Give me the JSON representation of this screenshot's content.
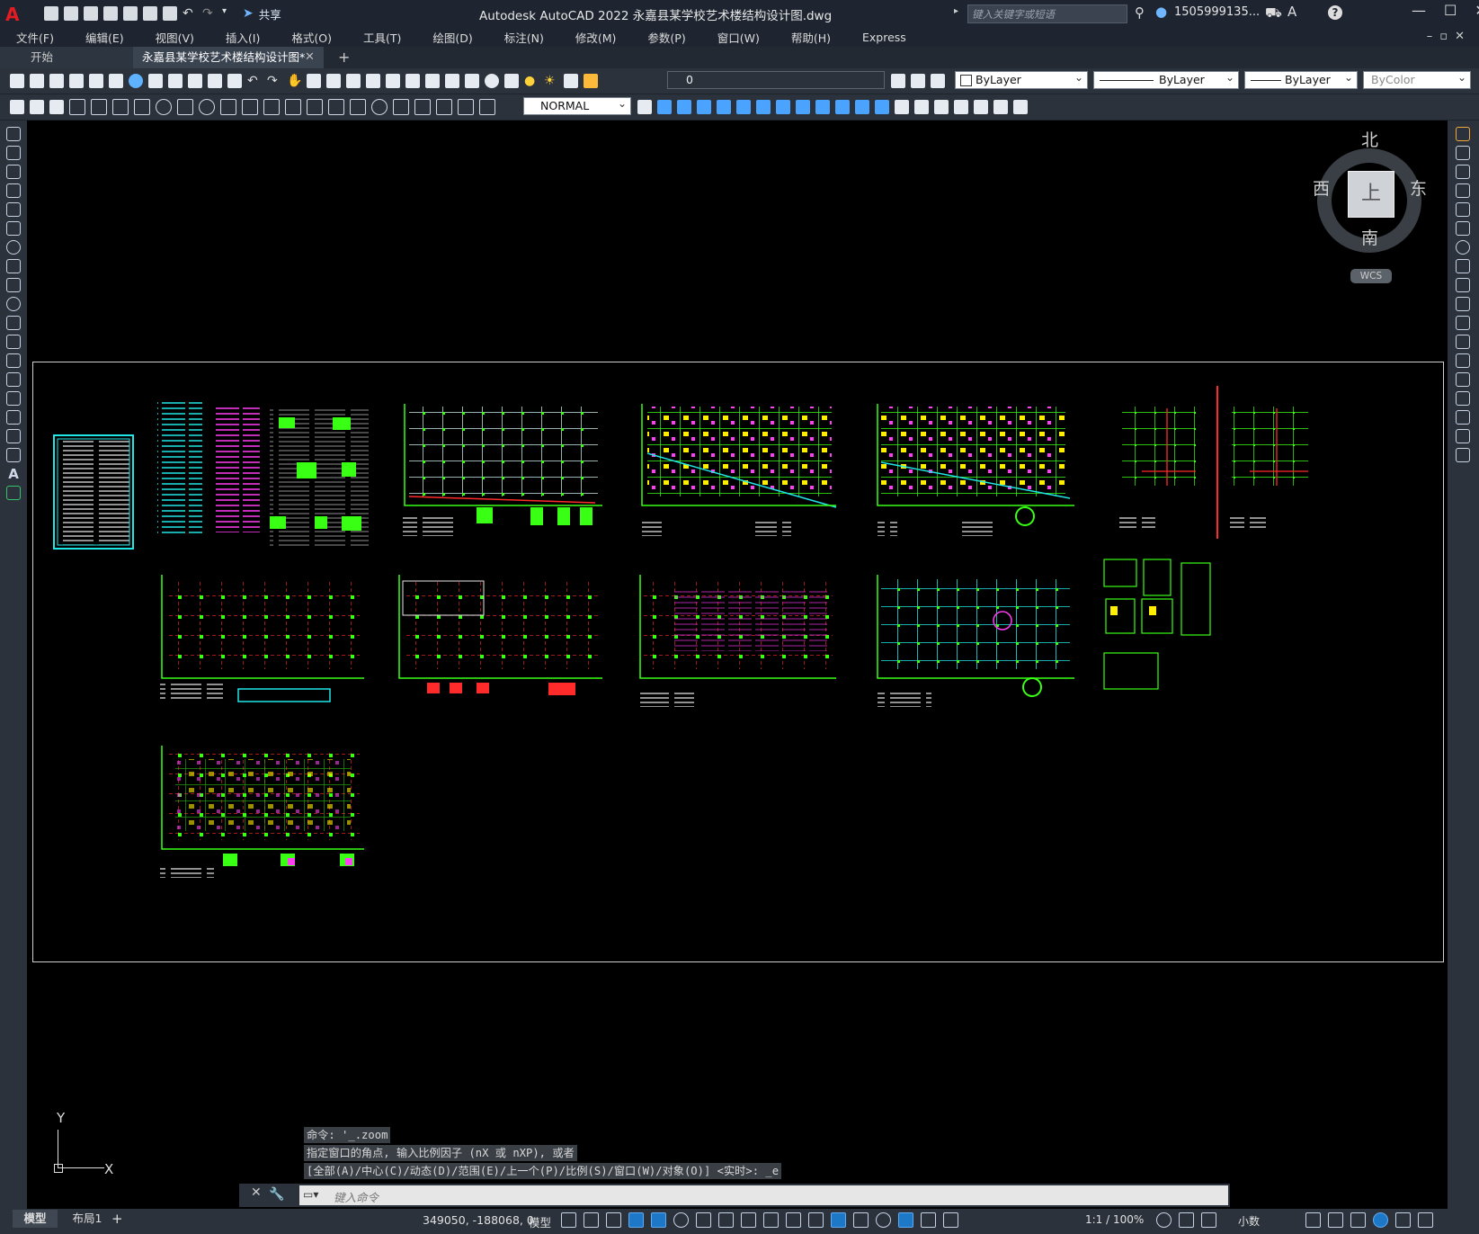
{
  "app": {
    "logo": "A",
    "title": "Autodesk AutoCAD 2022    永嘉县某学校艺术楼结构设计图.dwg",
    "share": "共享",
    "search_placeholder": "键入关键字或短语",
    "user": "1505999135...",
    "window_controls": [
      "—",
      "☐",
      "✕"
    ]
  },
  "menu": [
    "文件(F)",
    "编辑(E)",
    "视图(V)",
    "插入(I)",
    "格式(O)",
    "工具(T)",
    "绘图(D)",
    "标注(N)",
    "修改(M)",
    "参数(P)",
    "窗口(W)",
    "帮助(H)",
    "Express"
  ],
  "tabs": {
    "start": "开始",
    "file": "永嘉县某学校艺术楼结构设计图*",
    "close": "✕",
    "add": "+"
  },
  "properties": {
    "layer": "0",
    "color": "ByLayer",
    "linetype": "ByLayer",
    "lineweight": "ByLayer",
    "plotstyle": "ByColor",
    "dimstyle": "NORMAL"
  },
  "viewcube": {
    "north": "北",
    "south": "南",
    "east": "东",
    "west": "西",
    "face": "上",
    "wcs": "WCS"
  },
  "ucs": {
    "x": "X",
    "y": "Y"
  },
  "command": {
    "history": [
      "命令: '_.zoom",
      "指定窗口的角点, 输入比例因子 (nX 或 nXP), 或者",
      "[全部(A)/中心(C)/动态(D)/范围(E)/上一个(P)/比例(S)/窗口(W)/对象(O)] <实时>: _e"
    ],
    "placeholder": "键入命令"
  },
  "status": {
    "model_tab": "模型",
    "layout_tab": "布局1",
    "add_layout": "+",
    "coords": "349050, -188068, 0",
    "model_button": "模型",
    "scale": "1:1 / 100%",
    "units": "小数"
  },
  "colors": {
    "accent": "#1e78c8",
    "drawing_green": "#39ff14",
    "drawing_red": "#ff2a2a",
    "drawing_cyan": "#20e6e6",
    "drawing_yellow": "#ffee00",
    "drawing_magenta": "#ff3df3"
  }
}
